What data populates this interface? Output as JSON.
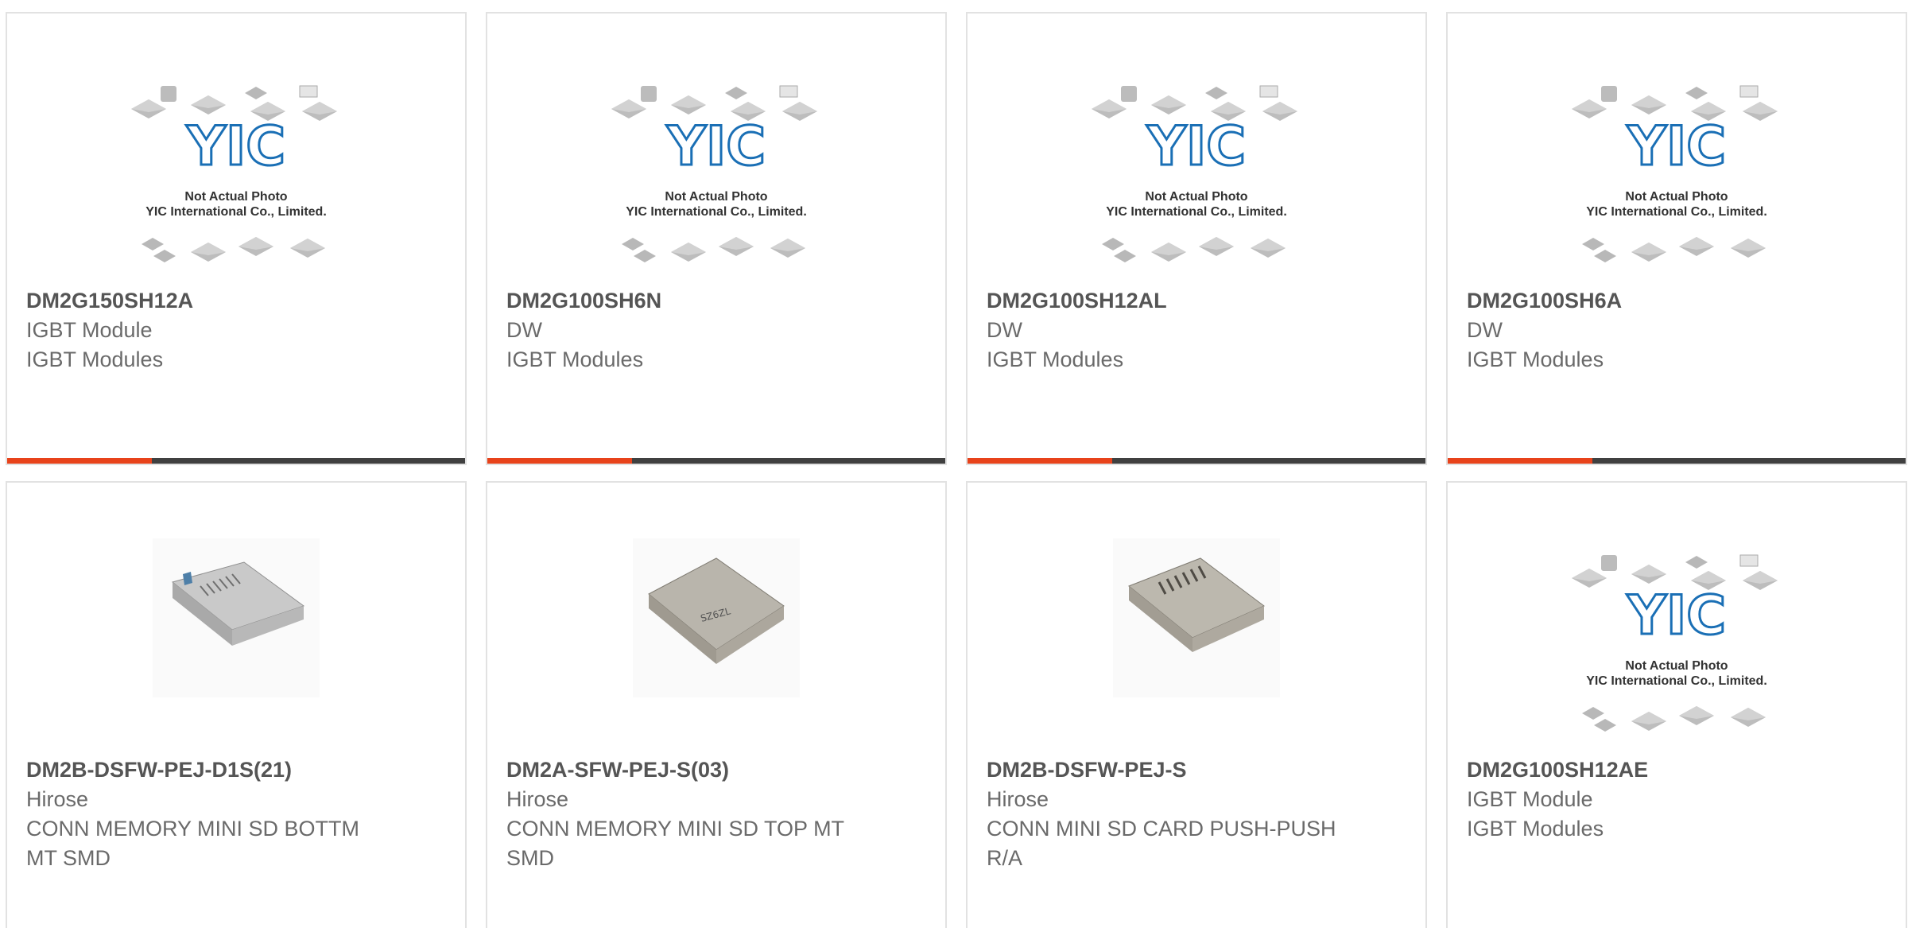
{
  "colors": {
    "accent": "#e8431b",
    "bar": "#404040",
    "logo_blue": "#1a6fb5",
    "part_text": "#555555",
    "meta_text": "#6a6a6a",
    "card_border": "#e2e2e2"
  },
  "placeholder": {
    "line1": "Not Actual Photo",
    "line2": "YIC International Co., Limited.",
    "logo": "YIC"
  },
  "products": [
    {
      "part": "DM2G150SH12A",
      "manufacturer": "IGBT Module",
      "description": "IGBT Modules",
      "image": "placeholder"
    },
    {
      "part": "DM2G100SH6N",
      "manufacturer": "DW",
      "description": "IGBT Modules",
      "image": "placeholder"
    },
    {
      "part": "DM2G100SH12AL",
      "manufacturer": "DW",
      "description": "IGBT Modules",
      "image": "placeholder"
    },
    {
      "part": "DM2G100SH6A",
      "manufacturer": "DW",
      "description": "IGBT Modules",
      "image": "placeholder"
    },
    {
      "part": "DM2B-DSFW-PEJ-D1S(21)",
      "manufacturer": "Hirose",
      "description": "CONN MEMORY MINI SD BOTTM MT SMD",
      "image": "sd-connector-photo"
    },
    {
      "part": "DM2A-SFW-PEJ-S(03)",
      "manufacturer": "Hirose",
      "description": "CONN MEMORY MINI SD TOP MT SMD",
      "image": "sd-connector-photo"
    },
    {
      "part": "DM2B-DSFW-PEJ-S",
      "manufacturer": "Hirose",
      "description": "CONN MINI SD CARD PUSH-PUSH R/A",
      "image": "sd-connector-photo"
    },
    {
      "part": "DM2G100SH12AE",
      "manufacturer": "IGBT Module",
      "description": "IGBT Modules",
      "image": "placeholder"
    }
  ]
}
